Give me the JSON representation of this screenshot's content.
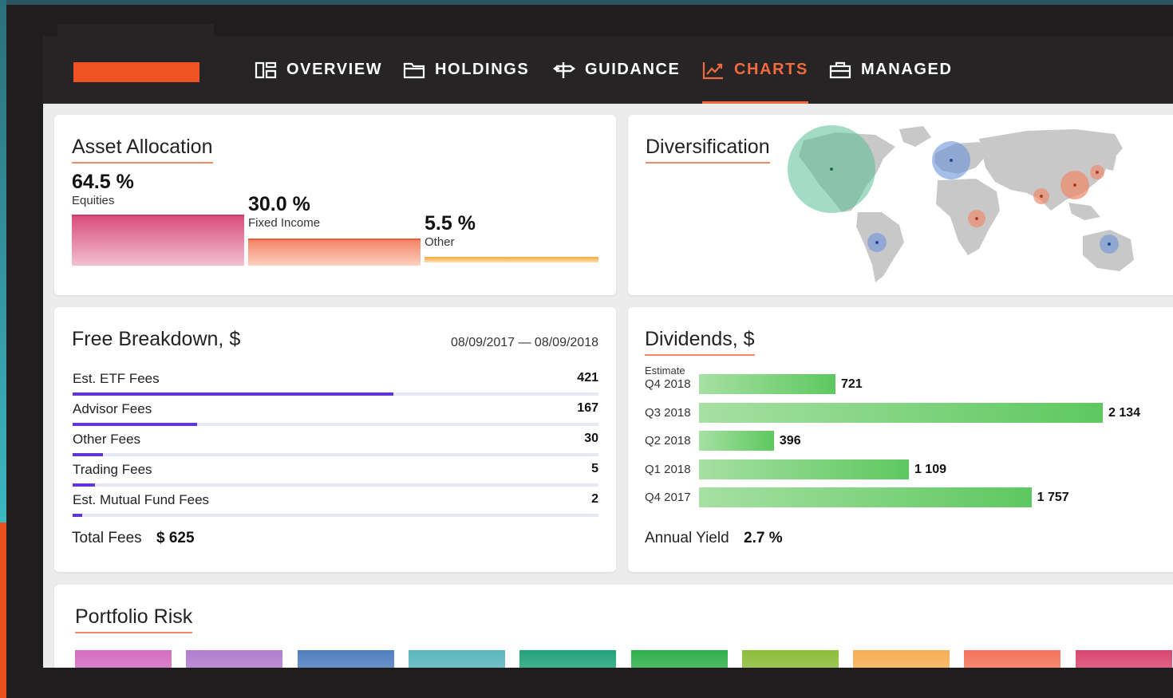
{
  "colors": {
    "accent": "#f26a3d",
    "logo": "#ef5323",
    "nav_bg": "#262425",
    "fee_bar": "#6335d8",
    "dividend_bar": "#5ec85f"
  },
  "nav": {
    "items": [
      {
        "label": "OVERVIEW",
        "icon": "overview-icon"
      },
      {
        "label": "HOLDINGS",
        "icon": "folder-icon"
      },
      {
        "label": "GUIDANCE",
        "icon": "signpost-icon"
      },
      {
        "label": "CHARTS",
        "icon": "chart-line-icon",
        "active": true
      },
      {
        "label": "MANAGED",
        "icon": "briefcase-icon"
      }
    ]
  },
  "asset_allocation": {
    "title": "Asset Allocation",
    "segments": [
      {
        "pct": "64.5 %",
        "label": "Equities",
        "value": 64.5,
        "color": "#d94e7b"
      },
      {
        "pct": "30.0 %",
        "label": "Fixed Income",
        "value": 30.0,
        "color": "#f26a4f"
      },
      {
        "pct": "5.5 %",
        "label": "Other",
        "value": 5.5,
        "color": "#f6a93b"
      }
    ]
  },
  "diversification": {
    "title": "Diversification"
  },
  "fees": {
    "title": "Free Breakdown, $",
    "date_range": "08/09/2017 — 08/09/2018",
    "rows": [
      {
        "label": "Est. ETF Fees",
        "value": "421",
        "fill": 0.61
      },
      {
        "label": "Advisor Fees",
        "value": "167",
        "fill": 0.237
      },
      {
        "label": "Other Fees",
        "value": "30",
        "fill": 0.058
      },
      {
        "label": "Trading Fees",
        "value": "5",
        "fill": 0.043
      },
      {
        "label": "Est. Mutual Fund Fees",
        "value": "2",
        "fill": 0.018
      }
    ],
    "total_label": "Total Fees",
    "total_value": "$ 625"
  },
  "dividends": {
    "title": "Dividends, $",
    "estimate_label": "Estimate",
    "annual_yield_label": "Annual Yield",
    "annual_yield_value": "2.7 %"
  },
  "chart_data": {
    "type": "bar",
    "orientation": "horizontal",
    "categories": [
      "Q4 2018",
      "Q3 2018",
      "Q2 2018",
      "Q1 2018",
      "Q4 2017"
    ],
    "values": [
      721,
      2134,
      396,
      1109,
      1757
    ],
    "value_labels": [
      "721",
      "2 134",
      "396",
      "1 109",
      "1 757"
    ],
    "title": "Dividends, $",
    "annotations": [
      "Estimate"
    ],
    "grid": false
  },
  "portfolio_risk": {
    "title": "Portfolio Risk",
    "swatches": [
      "#d46dc0",
      "#b07cd0",
      "#4f7fbf",
      "#5ab6bd",
      "#22a37a",
      "#2fb04a",
      "#8cbd3a",
      "#f7ad55",
      "#f4745a",
      "#d9466f"
    ]
  }
}
